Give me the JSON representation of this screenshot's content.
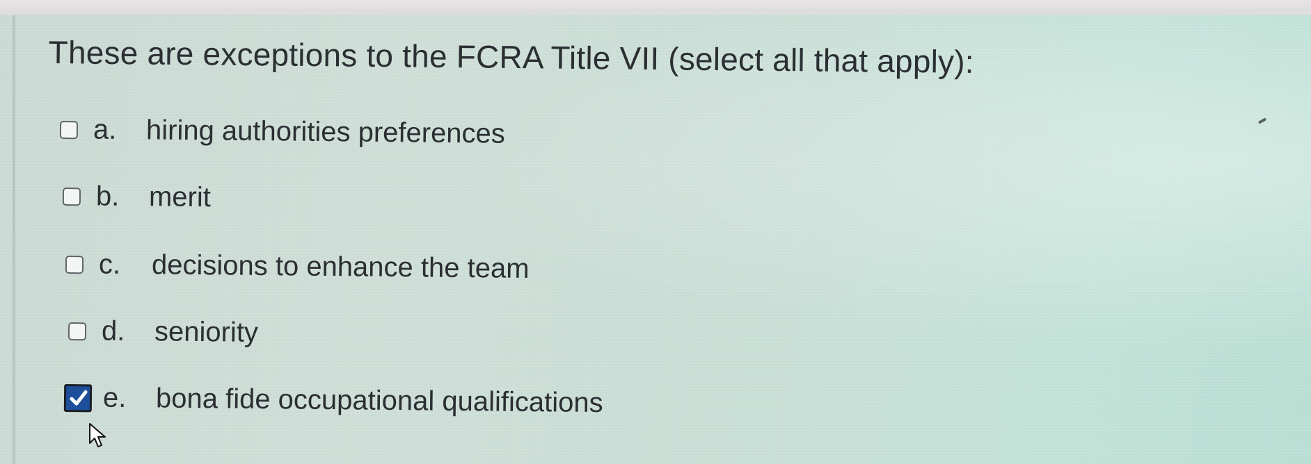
{
  "question": {
    "text": "These are exceptions to the FCRA Title VII (select all that apply):"
  },
  "options": [
    {
      "letter": "a.",
      "text": "hiring authorities preferences",
      "checked": false
    },
    {
      "letter": "b.",
      "text": "merit",
      "checked": false
    },
    {
      "letter": "c.",
      "text": "decisions to enhance the team",
      "checked": false
    },
    {
      "letter": "d.",
      "text": "seniority",
      "checked": false
    },
    {
      "letter": "e.",
      "text": "bona fide occupational qualifications",
      "checked": true
    }
  ],
  "icons": {
    "check": "check-icon",
    "cursor": "mouse-pointer-icon"
  },
  "colors": {
    "checked_fill": "#1d4f9a",
    "text": "#2b2f33"
  }
}
